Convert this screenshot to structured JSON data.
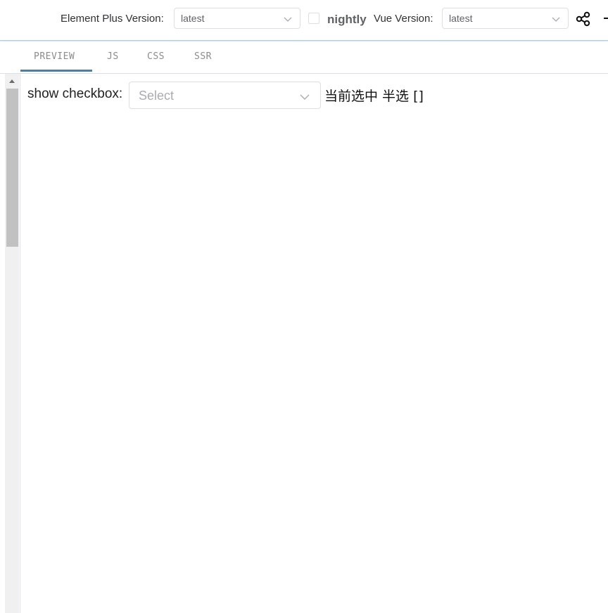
{
  "header": {
    "element_plus_label": "Element Plus Version:",
    "element_plus_value": "latest",
    "nightly_label": "nightly",
    "nightly_checked": false,
    "vue_label": "Vue Version:",
    "vue_value": "latest",
    "icons": [
      "chevron-down-icon",
      "share-icon",
      "more-icon"
    ]
  },
  "tabs": [
    {
      "label": "PREVIEW",
      "active": true
    },
    {
      "label": "JS",
      "active": false
    },
    {
      "label": "CSS",
      "active": false
    },
    {
      "label": "SSR",
      "active": false
    }
  ],
  "preview": {
    "label": "show checkbox:",
    "select_placeholder": "Select",
    "status_text": "当前选中 半选 []"
  },
  "colors": {
    "accent": "#4b7db5",
    "header_border": "#a9cdf4",
    "border": "#dcdfe6",
    "placeholder": "#a8abb2",
    "scroll_thumb": "#c1c1c1"
  }
}
